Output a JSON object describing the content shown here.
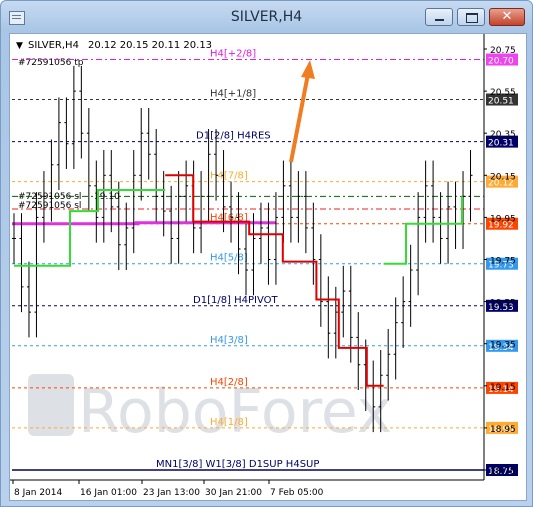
{
  "window": {
    "title": "SILVER,H4"
  },
  "chart_header": {
    "symbol": "SILVER,H4",
    "ohlc": "20.12 20.15 20.11 20.13",
    "order_tp": "#72591056 tp",
    "order_a": "#72591056 sl",
    "order_b": "#72591056 sl",
    "order_c": "19.10"
  },
  "watermark": "RoboForex",
  "colors": {
    "candles": "#000000",
    "trend_up": "#33dd33",
    "trend_down": "#dd0000",
    "pivot_band": "#dd33dd",
    "arrow": "#f07d22"
  },
  "chart_data": {
    "type": "candlestick",
    "title": "SILVER,H4",
    "ylim": [
      18.7,
      20.8
    ],
    "y_ticks": [
      "20.75",
      "20.55",
      "20.35",
      "20.15",
      "19.95",
      "19.75",
      "19.55",
      "19.35",
      "19.15",
      "18.95",
      "18.75"
    ],
    "x_ticks": [
      "8 Jan 2014",
      "16 Jan 01:00",
      "23 Jan 13:00",
      "30 Jan 21:00",
      "7 Feb 05:00"
    ],
    "levels": [
      {
        "label": "H4[+2/8]",
        "price": "20.70",
        "value": 20.7,
        "color": "#e020e0",
        "style": "dash-dot",
        "tag_bg": "#ee44ee"
      },
      {
        "label": "H4[+1/8]",
        "price": "20.51",
        "value": 20.51,
        "color": "#333333",
        "style": "dashed",
        "tag_bg": "#333333"
      },
      {
        "label": "D1[2/8] H4RES",
        "price": "20.31",
        "value": 20.31,
        "color": "#000066",
        "style": "dashed",
        "tag_bg": "#000066"
      },
      {
        "label": "H4[7/8]",
        "price": "20.12",
        "value": 20.12,
        "color": "#ffaa33",
        "style": "dashed",
        "tag_bg": "#ffaa33"
      },
      {
        "label": "H4[6/8]",
        "price": "19.92",
        "value": 19.92,
        "color": "#ff4400",
        "style": "dashed",
        "tag_bg": "#ff4400"
      },
      {
        "label": "H4[5/8]",
        "price": "19.73",
        "value": 19.73,
        "color": "#3399ee",
        "style": "dashed",
        "tag_bg": "#3399ee"
      },
      {
        "label": "D1[1/8] H4PIVOT",
        "price": "19.53",
        "value": 19.53,
        "color": "#000066",
        "style": "dashed",
        "tag_bg": "#000066"
      },
      {
        "label": "H4[3/8]",
        "price": "19.34",
        "value": 19.34,
        "color": "#3399ee",
        "style": "dashed",
        "tag_bg": "#3399ee"
      },
      {
        "label": "H4[2/8]",
        "price": "19.14",
        "value": 19.14,
        "color": "#ff4400",
        "style": "dashed",
        "tag_bg": "#ff4400"
      },
      {
        "label": "H4[1/8]",
        "price": "18.95",
        "value": 18.95,
        "color": "#ffaa33",
        "style": "dashed",
        "tag_bg": "#ffaa33"
      },
      {
        "label": "MN1[3/8] W1[3/8] D1SUP H4SUP",
        "price": "18.75",
        "value": 18.75,
        "color": "#000066",
        "style": "solid",
        "tag_bg": "#000066"
      }
    ],
    "order_lines": [
      {
        "value": 20.05,
        "color": "#006600"
      },
      {
        "value": 19.99,
        "color": "#ee2222"
      }
    ],
    "candles_close": [
      19.85,
      19.62,
      19.5,
      19.95,
      20.05,
      20.2,
      20.4,
      20.3,
      20.55,
      20.35,
      20.1,
      19.95,
      20.15,
      20.0,
      19.82,
      19.9,
      20.15,
      20.35,
      20.25,
      20.05,
      19.98,
      19.85,
      20.05,
      20.1,
      19.9,
      20.05,
      20.25,
      20.15,
      20.0,
      19.95,
      19.8,
      19.7,
      19.85,
      19.9,
      19.75,
      19.95,
      20.1,
      19.95,
      20.05,
      19.9,
      19.75,
      19.55,
      19.4,
      19.5,
      19.6,
      19.38,
      19.25,
      19.15,
      19.05,
      19.2,
      19.3,
      19.45,
      19.55,
      19.7,
      19.95,
      20.1,
      19.95,
      19.85,
      20.0,
      19.92,
      20.05,
      20.15
    ],
    "trend_up_segments": [
      [
        [
          0,
          19.72
        ],
        [
          10,
          19.72
        ],
        [
          10,
          19.98
        ],
        [
          15,
          19.98
        ],
        [
          15,
          20.08
        ],
        [
          27,
          20.08
        ]
      ],
      [
        [
          66,
          19.73
        ],
        [
          70,
          19.73
        ],
        [
          70,
          19.92
        ],
        [
          80,
          19.92
        ],
        [
          80,
          20.05
        ]
      ]
    ],
    "trend_down_segments": [
      [
        [
          27,
          20.15
        ],
        [
          32,
          20.15
        ],
        [
          32,
          19.93
        ],
        [
          42,
          19.93
        ],
        [
          42,
          19.87
        ],
        [
          48,
          19.87
        ],
        [
          48,
          19.74
        ],
        [
          54,
          19.74
        ],
        [
          54,
          19.56
        ],
        [
          58,
          19.56
        ],
        [
          58,
          19.33
        ],
        [
          63,
          19.33
        ],
        [
          63,
          19.15
        ],
        [
          66,
          19.15
        ]
      ]
    ],
    "pivot_band": [
      0.0,
      0.75,
      19.92
    ]
  }
}
